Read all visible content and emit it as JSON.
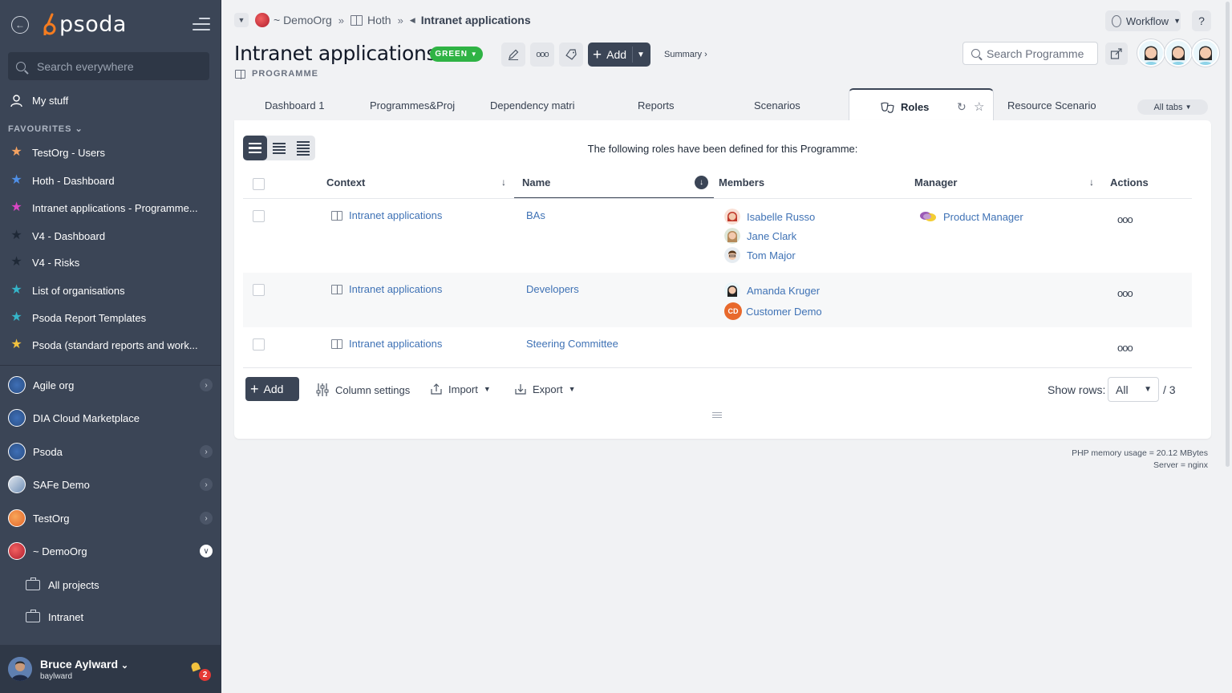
{
  "app": {
    "logo_text": "psoda",
    "brand_color": "#3b4556",
    "accent_color": "#f57c20"
  },
  "sidebar": {
    "search_placeholder": "Search everywhere",
    "my_stuff": "My stuff",
    "favourites_heading": "FAVOURITES",
    "favourites": [
      {
        "label": "TestOrg - Users",
        "star_color": "#f4a261"
      },
      {
        "label": "Hoth - Dashboard",
        "star_color": "#4f8fe6"
      },
      {
        "label": "Intranet applications - Programme...",
        "star_color": "#d946c4"
      },
      {
        "label": "V4 - Dashboard",
        "star_color": "#1f2937"
      },
      {
        "label": "V4 - Risks",
        "star_color": "#1f2937"
      },
      {
        "label": "List of organisations",
        "star_color": "#35b4c8"
      },
      {
        "label": "Psoda Report Templates",
        "star_color": "#35b4c8"
      },
      {
        "label": "Psoda (standard reports and work...",
        "star_color": "#f2c23e"
      }
    ],
    "orgs": [
      {
        "label": "Agile org",
        "has_chevron": true
      },
      {
        "label": "DIA Cloud Marketplace",
        "has_chevron": false
      },
      {
        "label": "Psoda",
        "has_chevron": true
      },
      {
        "label": "SAFe Demo",
        "has_chevron": true
      },
      {
        "label": "TestOrg",
        "has_chevron": true
      },
      {
        "label": "~ DemoOrg",
        "has_chevron": true,
        "expanded": true
      }
    ],
    "org_children": [
      "All projects",
      "Intranet"
    ],
    "user": {
      "name": "Bruce Aylward",
      "login": "baylward",
      "notifications": "2"
    }
  },
  "breadcrumb": {
    "org": "~ DemoOrg",
    "parent": "Hoth",
    "current": "Intranet applications"
  },
  "header": {
    "title": "Intranet applications",
    "status": "GREEN",
    "status_color": "#2fb344",
    "type_label": "PROGRAMME",
    "add_label": "Add",
    "summary_link": "Summary ›",
    "workflow_label": "Workflow",
    "help_label": "?",
    "search_placeholder": "Search Programme (",
    "more_label": "ooo"
  },
  "tabs": [
    {
      "label": "Dashboard 1"
    },
    {
      "label": "Programmes&Proj"
    },
    {
      "label": "Dependency matri"
    },
    {
      "label": "Reports"
    },
    {
      "label": "Scenarios"
    },
    {
      "label": "Roles",
      "active": true
    },
    {
      "label": "Resource Scenario"
    }
  ],
  "all_tabs_label": "All tabs",
  "table": {
    "intro": "The following roles have been defined for this Programme:",
    "columns": {
      "context": "Context",
      "name": "Name",
      "members": "Members",
      "manager": "Manager",
      "actions": "Actions"
    },
    "rows": [
      {
        "context": "Intranet applications",
        "name": "BAs",
        "members": [
          "Isabelle Russo",
          "Jane Clark",
          "Tom Major"
        ],
        "manager": "Product Manager",
        "actions": "ooo"
      },
      {
        "context": "Intranet applications",
        "name": "Developers",
        "members": [
          "Amanda Kruger",
          "Customer Demo"
        ],
        "manager": "",
        "actions": "ooo"
      },
      {
        "context": "Intranet applications",
        "name": "Steering Committee",
        "members": [],
        "manager": "",
        "actions": "ooo"
      }
    ],
    "member_initials": "CD"
  },
  "footer": {
    "add_label": "Add",
    "column_settings": "Column settings",
    "import": "Import",
    "export": "Export",
    "show_rows_label": "Show rows:",
    "show_rows_value": "All",
    "total": "/ 3"
  },
  "server_info": {
    "memory": "PHP memory usage = 20.12 MBytes",
    "server": "Server = nginx"
  }
}
